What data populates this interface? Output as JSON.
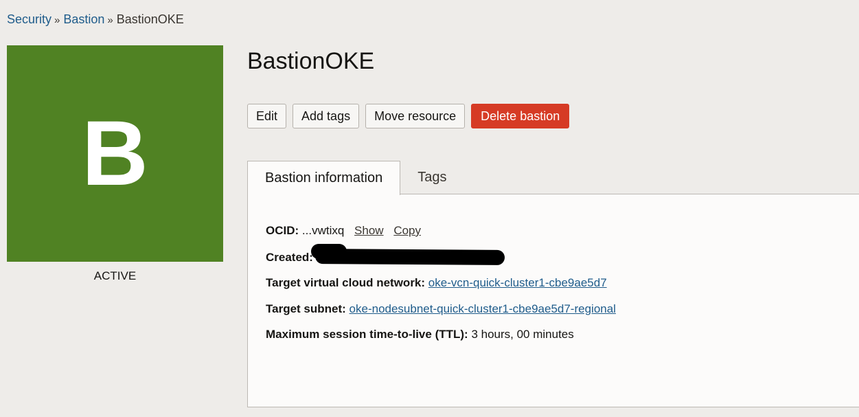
{
  "breadcrumb": {
    "items": [
      "Security",
      "Bastion"
    ],
    "separator": "»",
    "current": "BastionOKE"
  },
  "avatar": {
    "letter": "B",
    "color": "#508223"
  },
  "status": "ACTIVE",
  "title": "BastionOKE",
  "actions": {
    "edit": "Edit",
    "add_tags": "Add tags",
    "move_resource": "Move resource",
    "delete": "Delete bastion",
    "delete_color": "#d63b25"
  },
  "tabs": [
    "Bastion information",
    "Tags"
  ],
  "info": {
    "ocid_label": "OCID:",
    "ocid_value": "...vwtixq",
    "show": "Show",
    "copy": "Copy",
    "created_label": "Created:",
    "vcn_label": "Target virtual cloud network:",
    "vcn_value": "oke-vcn-quick-cluster1-cbe9ae5d7",
    "subnet_label": "Target subnet:",
    "subnet_value": "oke-nodesubnet-quick-cluster1-cbe9ae5d7-regional",
    "ttl_label": "Maximum session time-to-live (TTL):",
    "ttl_value": "3 hours, 00 minutes"
  },
  "colors": {
    "link": "#1f5c8b",
    "background": "#eeece9"
  }
}
